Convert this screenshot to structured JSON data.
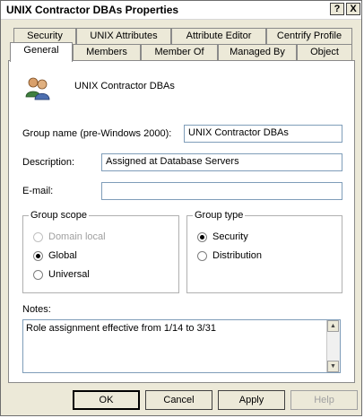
{
  "window": {
    "title": "UNIX Contractor DBAs Properties",
    "help_glyph": "?",
    "close_glyph": "X"
  },
  "tabs": {
    "row1": [
      "Security",
      "UNIX Attributes",
      "Attribute Editor",
      "Centrify Profile"
    ],
    "row2": [
      "General",
      "Members",
      "Member Of",
      "Managed By",
      "Object"
    ],
    "active": "General"
  },
  "general": {
    "group_display_name": "UNIX Contractor DBAs",
    "group_name_label": "Group name (pre-Windows 2000):",
    "group_name_value": "UNIX Contractor DBAs",
    "description_label": "Description:",
    "description_value": "Assigned at Database Servers",
    "email_label": "E-mail:",
    "email_value": "",
    "group_scope": {
      "legend": "Group scope",
      "options": [
        "Domain local",
        "Global",
        "Universal"
      ],
      "selected": "Global",
      "disabled": [
        "Domain local"
      ]
    },
    "group_type": {
      "legend": "Group type",
      "options": [
        "Security",
        "Distribution"
      ],
      "selected": "Security"
    },
    "notes_label": "Notes:",
    "notes_value": "Role assignment effective from 1/14 to 3/31"
  },
  "buttons": {
    "ok": "OK",
    "cancel": "Cancel",
    "apply": "Apply",
    "help": "Help"
  },
  "icons": {
    "group": "users-group-icon",
    "scroll_up": "scroll-up-arrow-icon",
    "scroll_down": "scroll-down-arrow-icon"
  }
}
